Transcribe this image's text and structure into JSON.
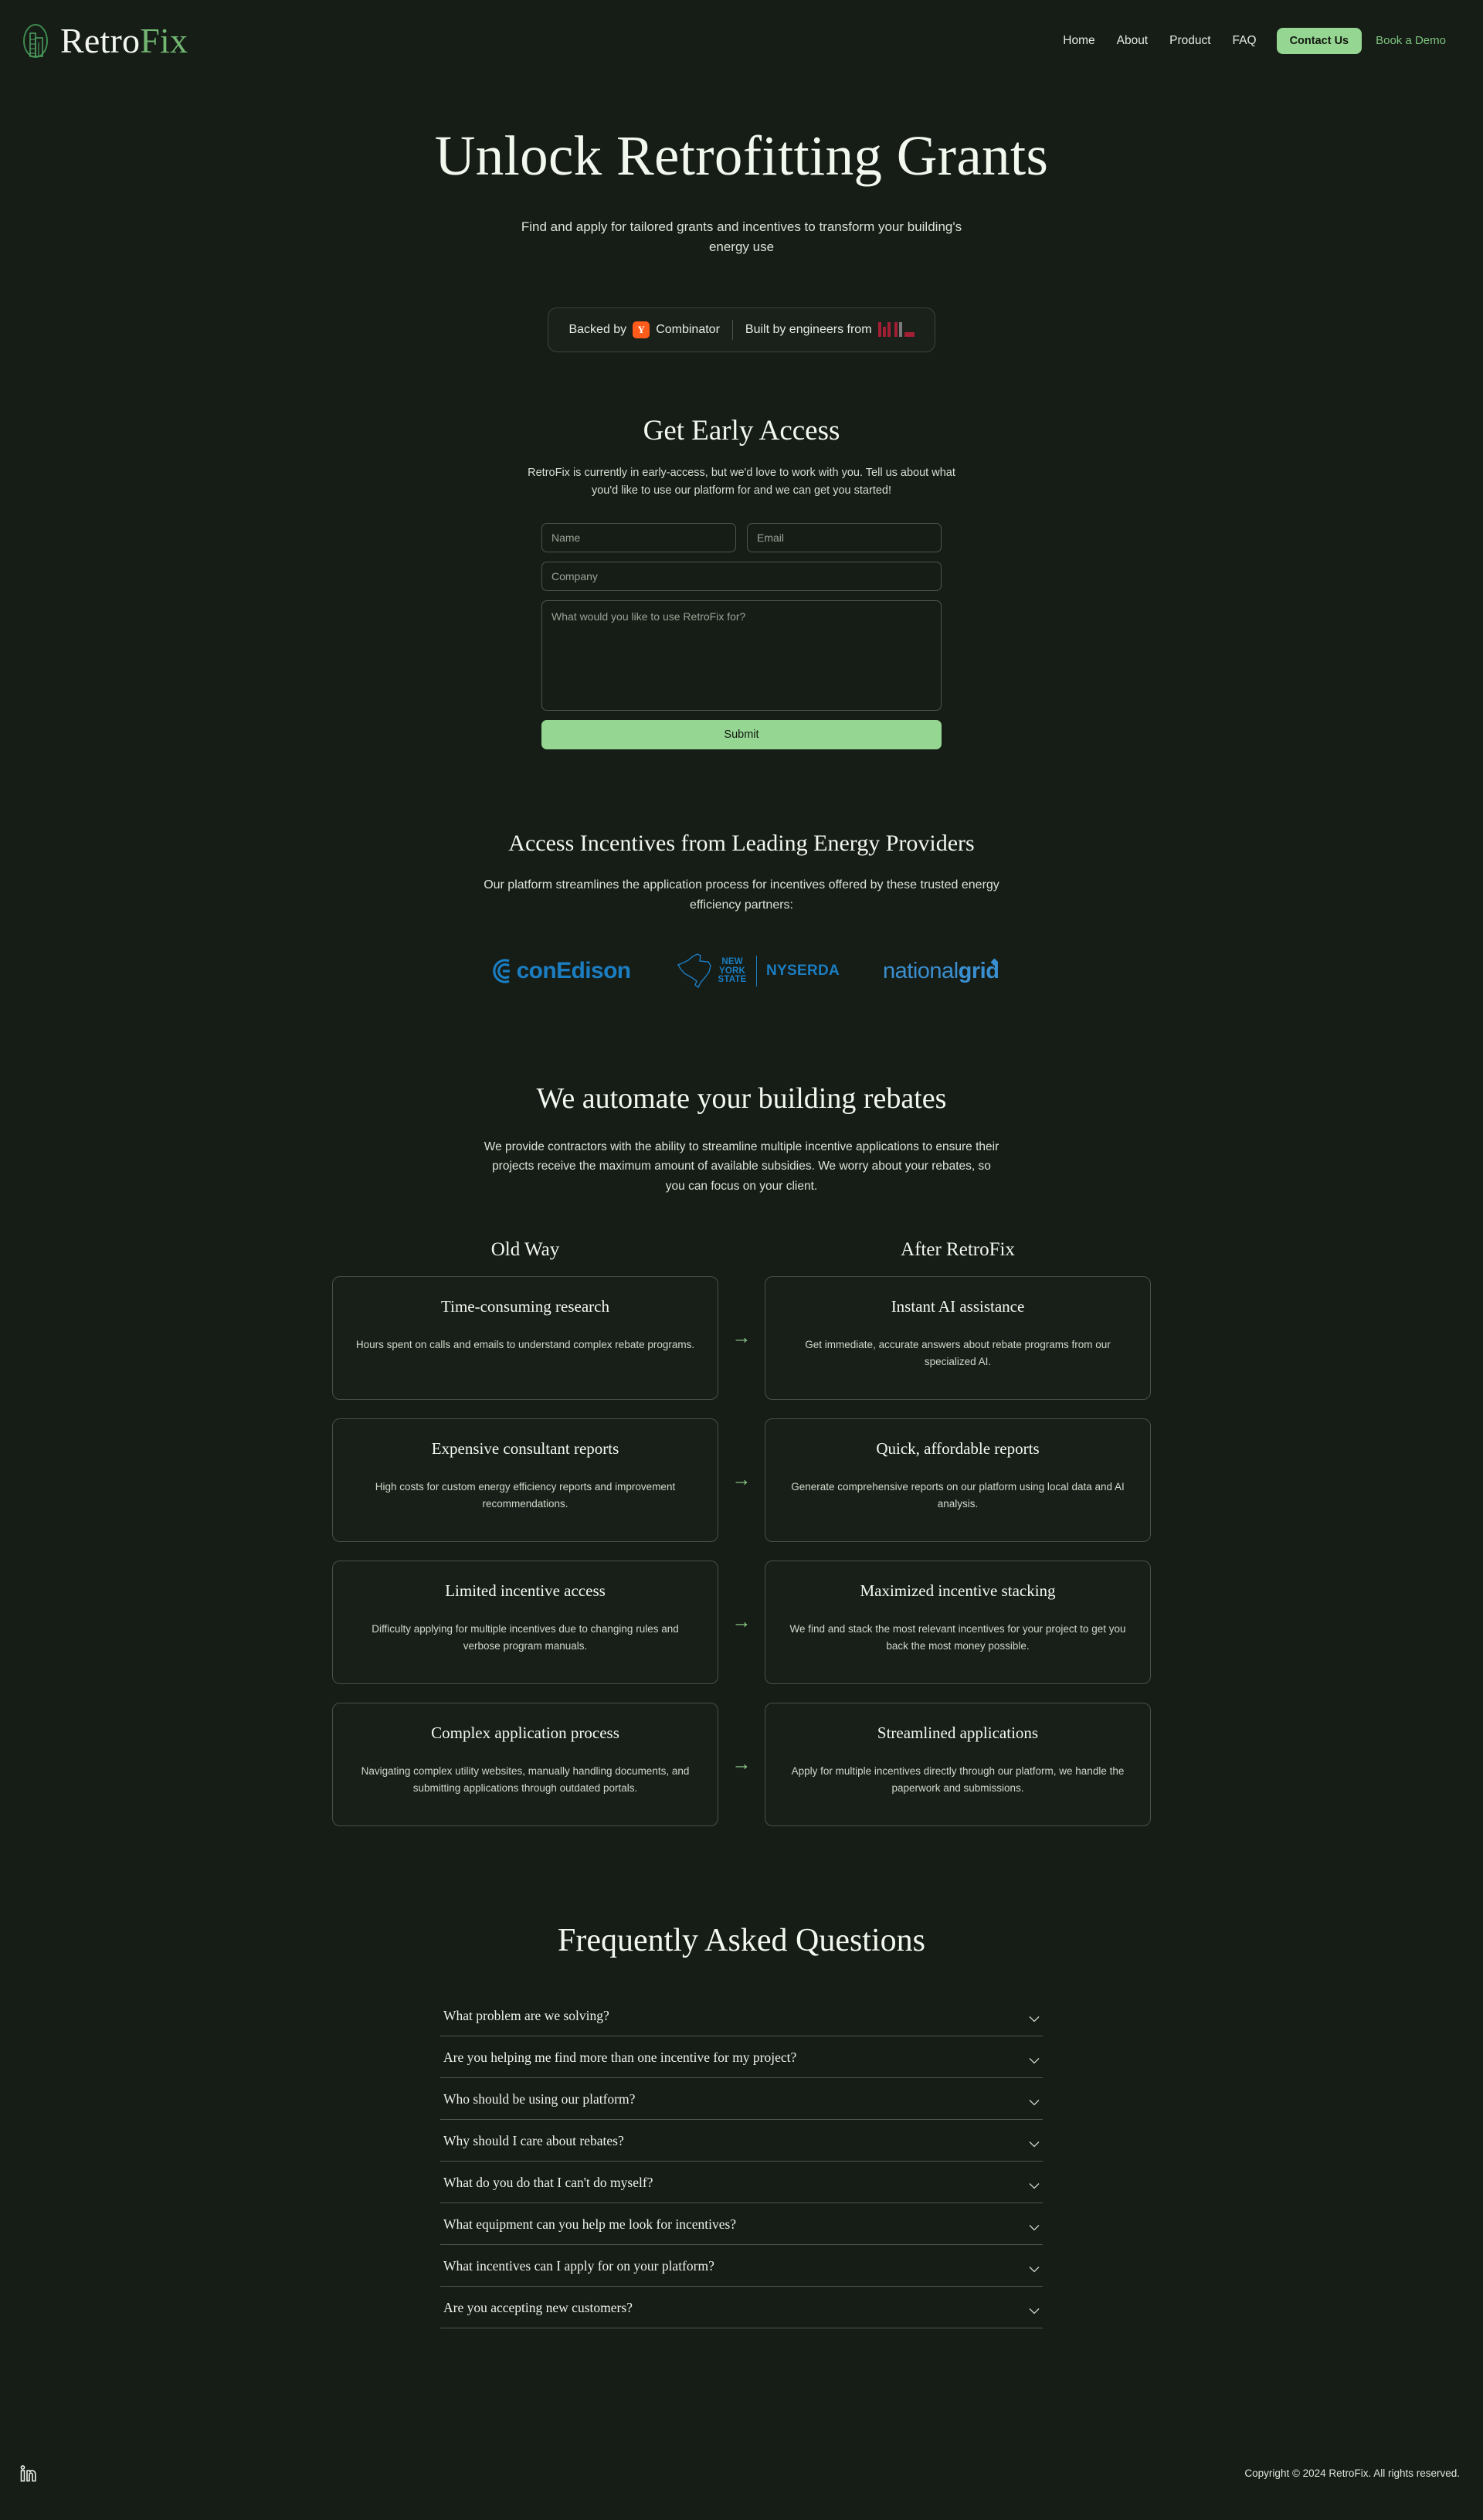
{
  "brand": {
    "name_white": "Retro",
    "name_green": "Fix",
    "logo_icon": "building-circle-icon"
  },
  "nav": {
    "links": [
      {
        "label": "Home"
      },
      {
        "label": "About"
      },
      {
        "label": "Product"
      },
      {
        "label": "FAQ"
      }
    ],
    "cta_label": "Contact Us",
    "demo_label": "Book a Demo"
  },
  "hero": {
    "title": "Unlock Retrofitting Grants",
    "subtitle": "Find and apply for tailored grants and incentives to transform your building's energy use"
  },
  "badges": {
    "backed_prefix": "Backed by",
    "backed_suffix": "Combinator",
    "yc_letter": "Y",
    "built_text": "Built by engineers from",
    "mit_label": "MIT"
  },
  "early_access": {
    "title": "Get Early Access",
    "lead": "RetroFix is currently in early-access, but we'd love to work with you. Tell us about what you'd like to use our platform for and we can get you started!",
    "name_placeholder": "Name",
    "email_placeholder": "Email",
    "company_placeholder": "Company",
    "message_placeholder": "What would you like to use RetroFix for?",
    "name_value": "",
    "email_value": "",
    "company_value": "",
    "message_value": "",
    "submit_label": "Submit"
  },
  "providers": {
    "title": "Access Incentives from Leading Energy Providers",
    "subtitle": "Our platform streamlines the application process for incentives offered by these trusted energy efficiency partners:",
    "logos": [
      {
        "name": "conEdison",
        "text": "conEdison",
        "color": "#1b7ec2"
      },
      {
        "name": "NYSERDA",
        "line1": "NEW",
        "line2": "YORK",
        "line3": "STATE",
        "text": "NYSERDA",
        "color": "#1b7ec2"
      },
      {
        "name": "nationalgrid",
        "light": "national",
        "bold": "grid",
        "color": "#3a8fd0"
      }
    ]
  },
  "automate": {
    "title": "We automate your building rebates",
    "subtitle": "We provide contractors with the ability to streamline multiple incentive applications to ensure their projects receive the maximum amount of available subsidies. We worry about your rebates, so you can focus on your client.",
    "head_left": "Old Way",
    "head_right": "After RetroFix",
    "rows": [
      {
        "old_title": "Time-consuming research",
        "old_desc": "Hours spent on calls and emails to understand complex rebate programs.",
        "new_title": "Instant AI assistance",
        "new_desc": "Get immediate, accurate answers about rebate programs from our specialized AI."
      },
      {
        "old_title": "Expensive consultant reports",
        "old_desc": "High costs for custom energy efficiency reports and improvement recommendations.",
        "new_title": "Quick, affordable reports",
        "new_desc": "Generate comprehensive reports on our platform using local data and AI analysis."
      },
      {
        "old_title": "Limited incentive access",
        "old_desc": "Difficulty applying for multiple incentives due to changing rules and verbose program manuals.",
        "new_title": "Maximized incentive stacking",
        "new_desc": "We find and stack the most relevant incentives for your project to get you back the most money possible."
      },
      {
        "old_title": "Complex application process",
        "old_desc": "Navigating complex utility websites, manually handling documents, and submitting applications through outdated portals.",
        "new_title": "Streamlined applications",
        "new_desc": "Apply for multiple incentives directly through our platform, we handle the paperwork and submissions."
      }
    ]
  },
  "faq": {
    "title": "Frequently Asked Questions",
    "items": [
      {
        "question": "What problem are we solving?"
      },
      {
        "question": "Are you helping me find more than one incentive for my project?"
      },
      {
        "question": "Who should be using our platform?"
      },
      {
        "question": "Why should I care about rebates?"
      },
      {
        "question": "What do you do that I can't do myself?"
      },
      {
        "question": "What equipment can you help me look for incentives?"
      },
      {
        "question": "What incentives can I apply for on your platform?"
      },
      {
        "question": "Are you accepting new customers?"
      }
    ]
  },
  "footer": {
    "linkedin_icon": "linkedin-icon",
    "copyright": "Copyright © 2024 RetroFix. All rights reserved."
  },
  "colors": {
    "background": "#161c16",
    "accent_green": "#96d693",
    "link_green": "#7fc47f",
    "text_primary": "#f3f8ef",
    "yc_orange": "#ff5b1a",
    "mit_red": "#a31f34",
    "utility_blue": "#1b7ec2"
  }
}
